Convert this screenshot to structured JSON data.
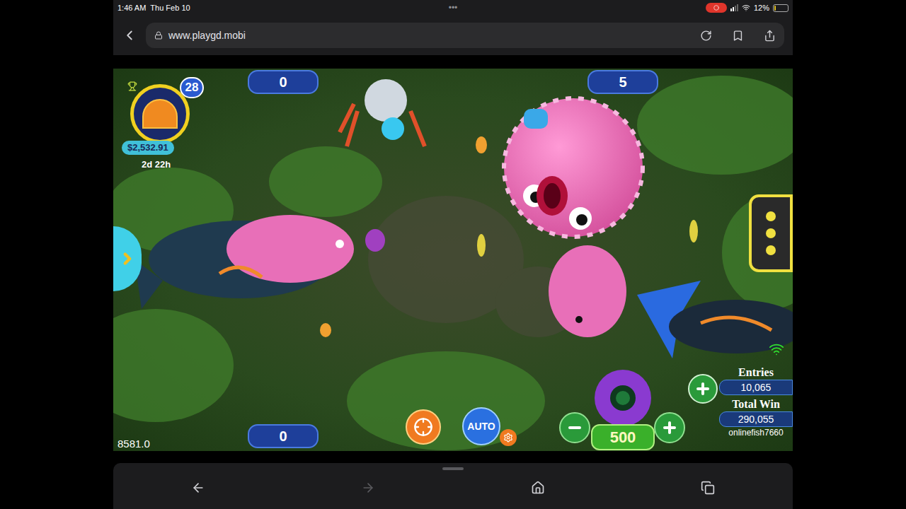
{
  "status_bar": {
    "time": "1:46 AM",
    "date": "Thu Feb 10",
    "dots": "•••",
    "battery_text": "12%",
    "battery_level": 0.12,
    "screen_recording": true
  },
  "browser": {
    "url": "www.playgd.mobi"
  },
  "game": {
    "jackpot": {
      "badge": "28",
      "amount": "$2,532.91",
      "timer": "2d 22h"
    },
    "seats": [
      {
        "score": "0",
        "position": "top-left"
      },
      {
        "score": "5",
        "position": "top-right"
      },
      {
        "score": "0",
        "position": "bottom-left"
      }
    ],
    "credits": "8581.0",
    "auto_button": "AUTO",
    "bet": "500",
    "entries_label": "Entries",
    "entries": "10,065",
    "total_win_label": "Total Win",
    "total_win": "290,055",
    "username": "onlinefish7660"
  },
  "toolbar": [
    {
      "kind": "back",
      "disabled": false
    },
    {
      "kind": "forward",
      "disabled": true
    },
    {
      "kind": "home",
      "disabled": false
    },
    {
      "kind": "tabs",
      "disabled": false
    }
  ]
}
